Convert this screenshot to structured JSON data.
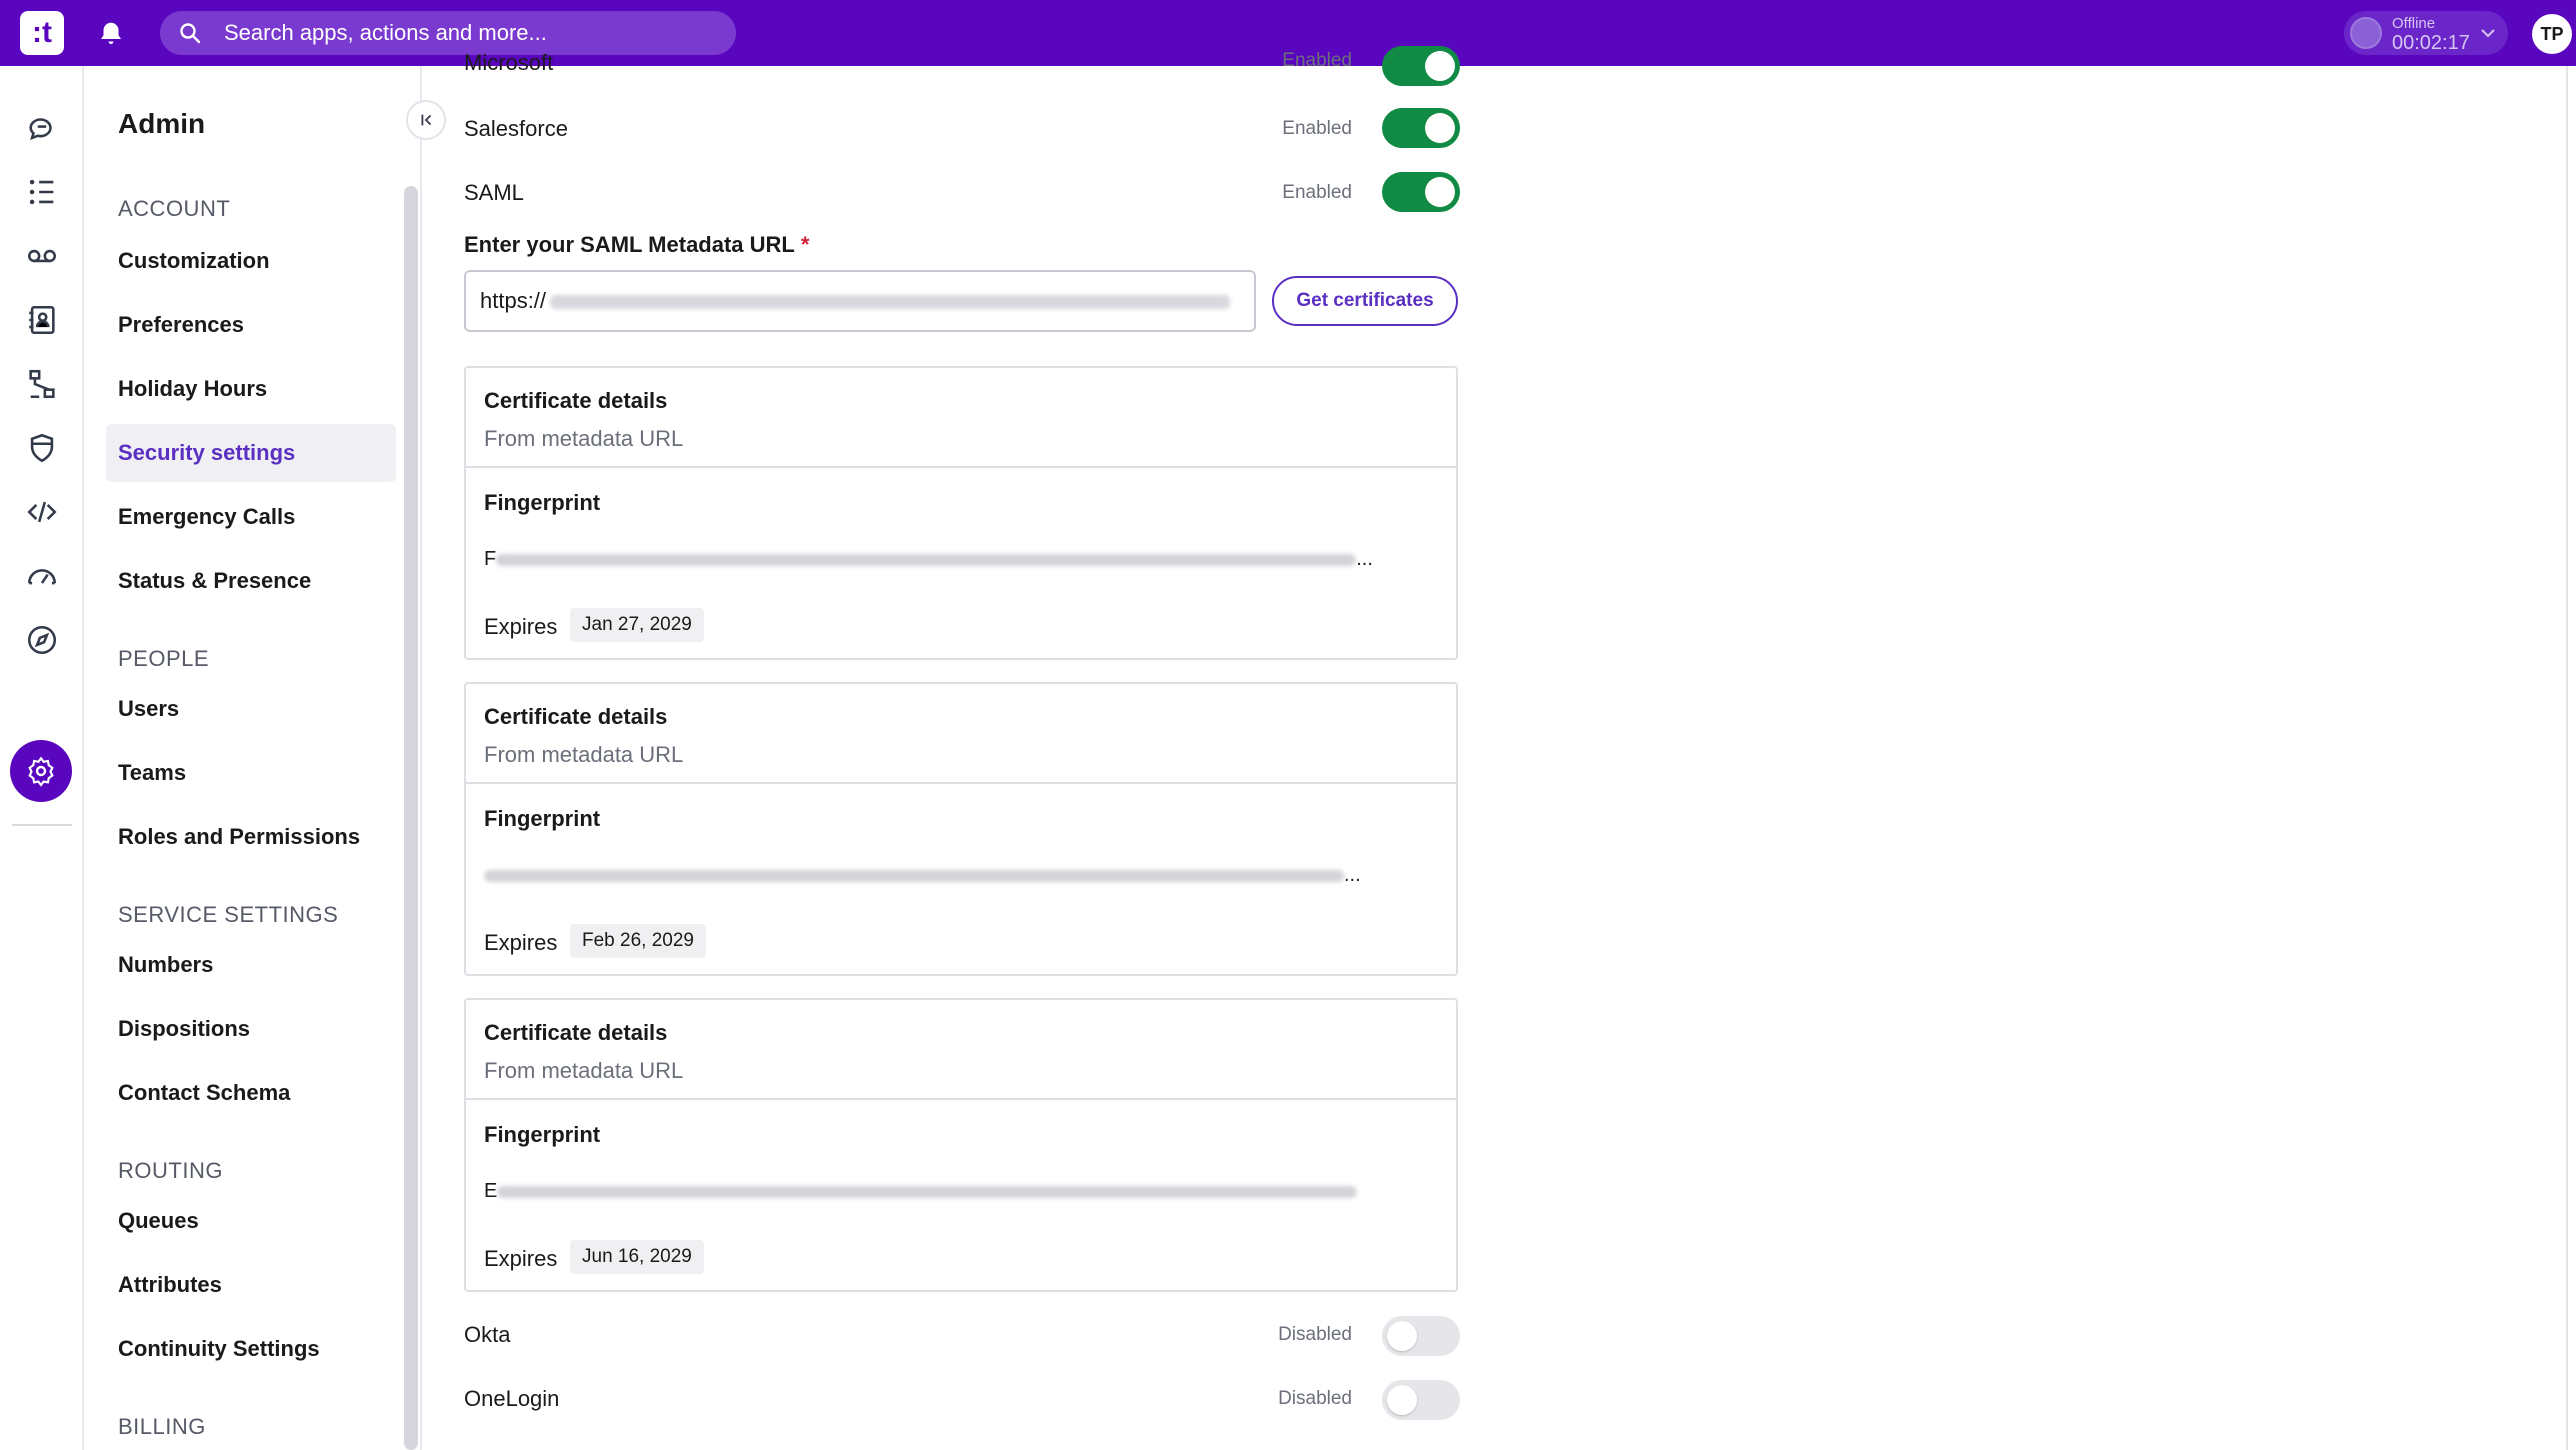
{
  "topbar": {
    "logo_text": ":t",
    "search_placeholder": "Search apps, actions and more...",
    "status_label": "Offline",
    "status_timer": "00:02:17",
    "avatar_initials": "TP",
    "brand_color": "#5a06bf"
  },
  "rail": {
    "icons": [
      "conversations-icon",
      "list-icon",
      "voicemail-icon",
      "contacts-icon",
      "flows-icon",
      "shield-icon",
      "code-icon",
      "dashboard-icon",
      "compass-icon",
      "settings-icon"
    ],
    "active": "settings-icon"
  },
  "nav": {
    "title": "Admin",
    "sections": {
      "account": "ACCOUNT",
      "people": "PEOPLE",
      "service": "SERVICE SETTINGS",
      "routing": "ROUTING",
      "billing": "BILLING"
    },
    "items": {
      "customization": "Customization",
      "preferences": "Preferences",
      "holiday": "Holiday Hours",
      "security": "Security settings",
      "emergency": "Emergency Calls",
      "status": "Status & Presence",
      "users": "Users",
      "teams": "Teams",
      "roles": "Roles and Permissions",
      "numbers": "Numbers",
      "dispositions": "Dispositions",
      "contact_schema": "Contact Schema",
      "queues": "Queues",
      "attributes": "Attributes",
      "continuity": "Continuity Settings"
    },
    "active_item": "Security settings"
  },
  "main": {
    "providers": {
      "microsoft": {
        "label": "Microsoft",
        "status": "Enabled",
        "enabled": true
      },
      "salesforce": {
        "label": "Salesforce",
        "status": "Enabled",
        "enabled": true
      },
      "saml": {
        "label": "SAML",
        "status": "Enabled",
        "enabled": true
      },
      "okta": {
        "label": "Okta",
        "status": "Disabled",
        "enabled": false
      },
      "onelogin": {
        "label": "OneLogin",
        "status": "Disabled",
        "enabled": false
      }
    },
    "saml_field": {
      "label": "Enter your SAML Metadata URL",
      "required_mark": "*",
      "value_prefix": "https://",
      "button": "Get certificates"
    },
    "certificates": [
      {
        "title": "Certificate details",
        "source": "From metadata URL",
        "fp_label": "Fingerprint",
        "fp_start": "F",
        "expires_label": "Expires",
        "expires": "Jan 27, 2029"
      },
      {
        "title": "Certificate details",
        "source": "From metadata URL",
        "fp_label": "Fingerprint",
        "fp_start": "",
        "expires_label": "Expires",
        "expires": "Feb 26, 2029"
      },
      {
        "title": "Certificate details",
        "source": "From metadata URL",
        "fp_label": "Fingerprint",
        "fp_start": "E",
        "expires_label": "Expires",
        "expires": "Jun 16, 2029"
      }
    ],
    "toggle_on_color": "#118a45",
    "ellipsis": "..."
  }
}
